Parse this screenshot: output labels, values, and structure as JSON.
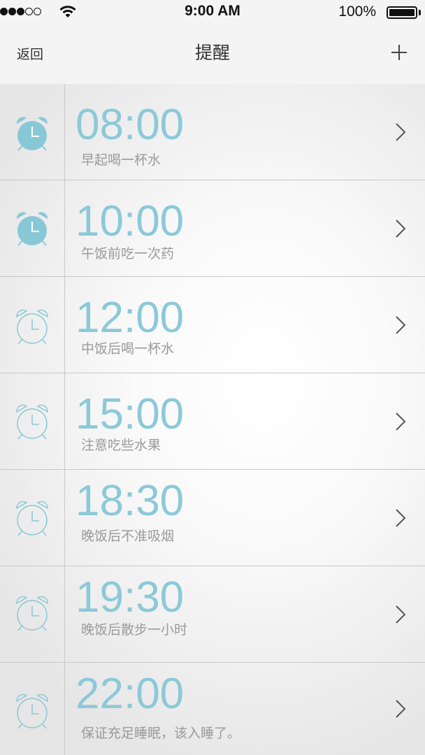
{
  "status_bar": {
    "time": "9:00 AM",
    "battery_percent": "100%",
    "signal_filled": 3,
    "signal_total": 5
  },
  "nav": {
    "back_label": "返回",
    "title": "提醒",
    "add_icon": "plus-icon"
  },
  "colors": {
    "accent": "#8cc9d8",
    "icon_active": "#88c8d6"
  },
  "reminders": [
    {
      "time": "08:00",
      "note": "早起喝一杯水",
      "icon": "alarm-clock-icon",
      "icon_style": "filled"
    },
    {
      "time": "10:00",
      "note": "午饭前吃一次药",
      "icon": "alarm-clock-icon",
      "icon_style": "filled"
    },
    {
      "time": "12:00",
      "note": "中饭后喝一杯水",
      "icon": "alarm-clock-icon",
      "icon_style": "outline"
    },
    {
      "time": "15:00",
      "note": "注意吃些水果",
      "icon": "alarm-clock-icon",
      "icon_style": "outline"
    },
    {
      "time": "18:30",
      "note": "晚饭后不准吸烟",
      "icon": "alarm-clock-icon",
      "icon_style": "outline"
    },
    {
      "time": "19:30",
      "note": "晚饭后散步一小时",
      "icon": "alarm-clock-icon",
      "icon_style": "outline"
    },
    {
      "time": "22:00",
      "note": "保证充足睡眠，该入睡了。",
      "icon": "alarm-clock-icon",
      "icon_style": "outline"
    }
  ]
}
